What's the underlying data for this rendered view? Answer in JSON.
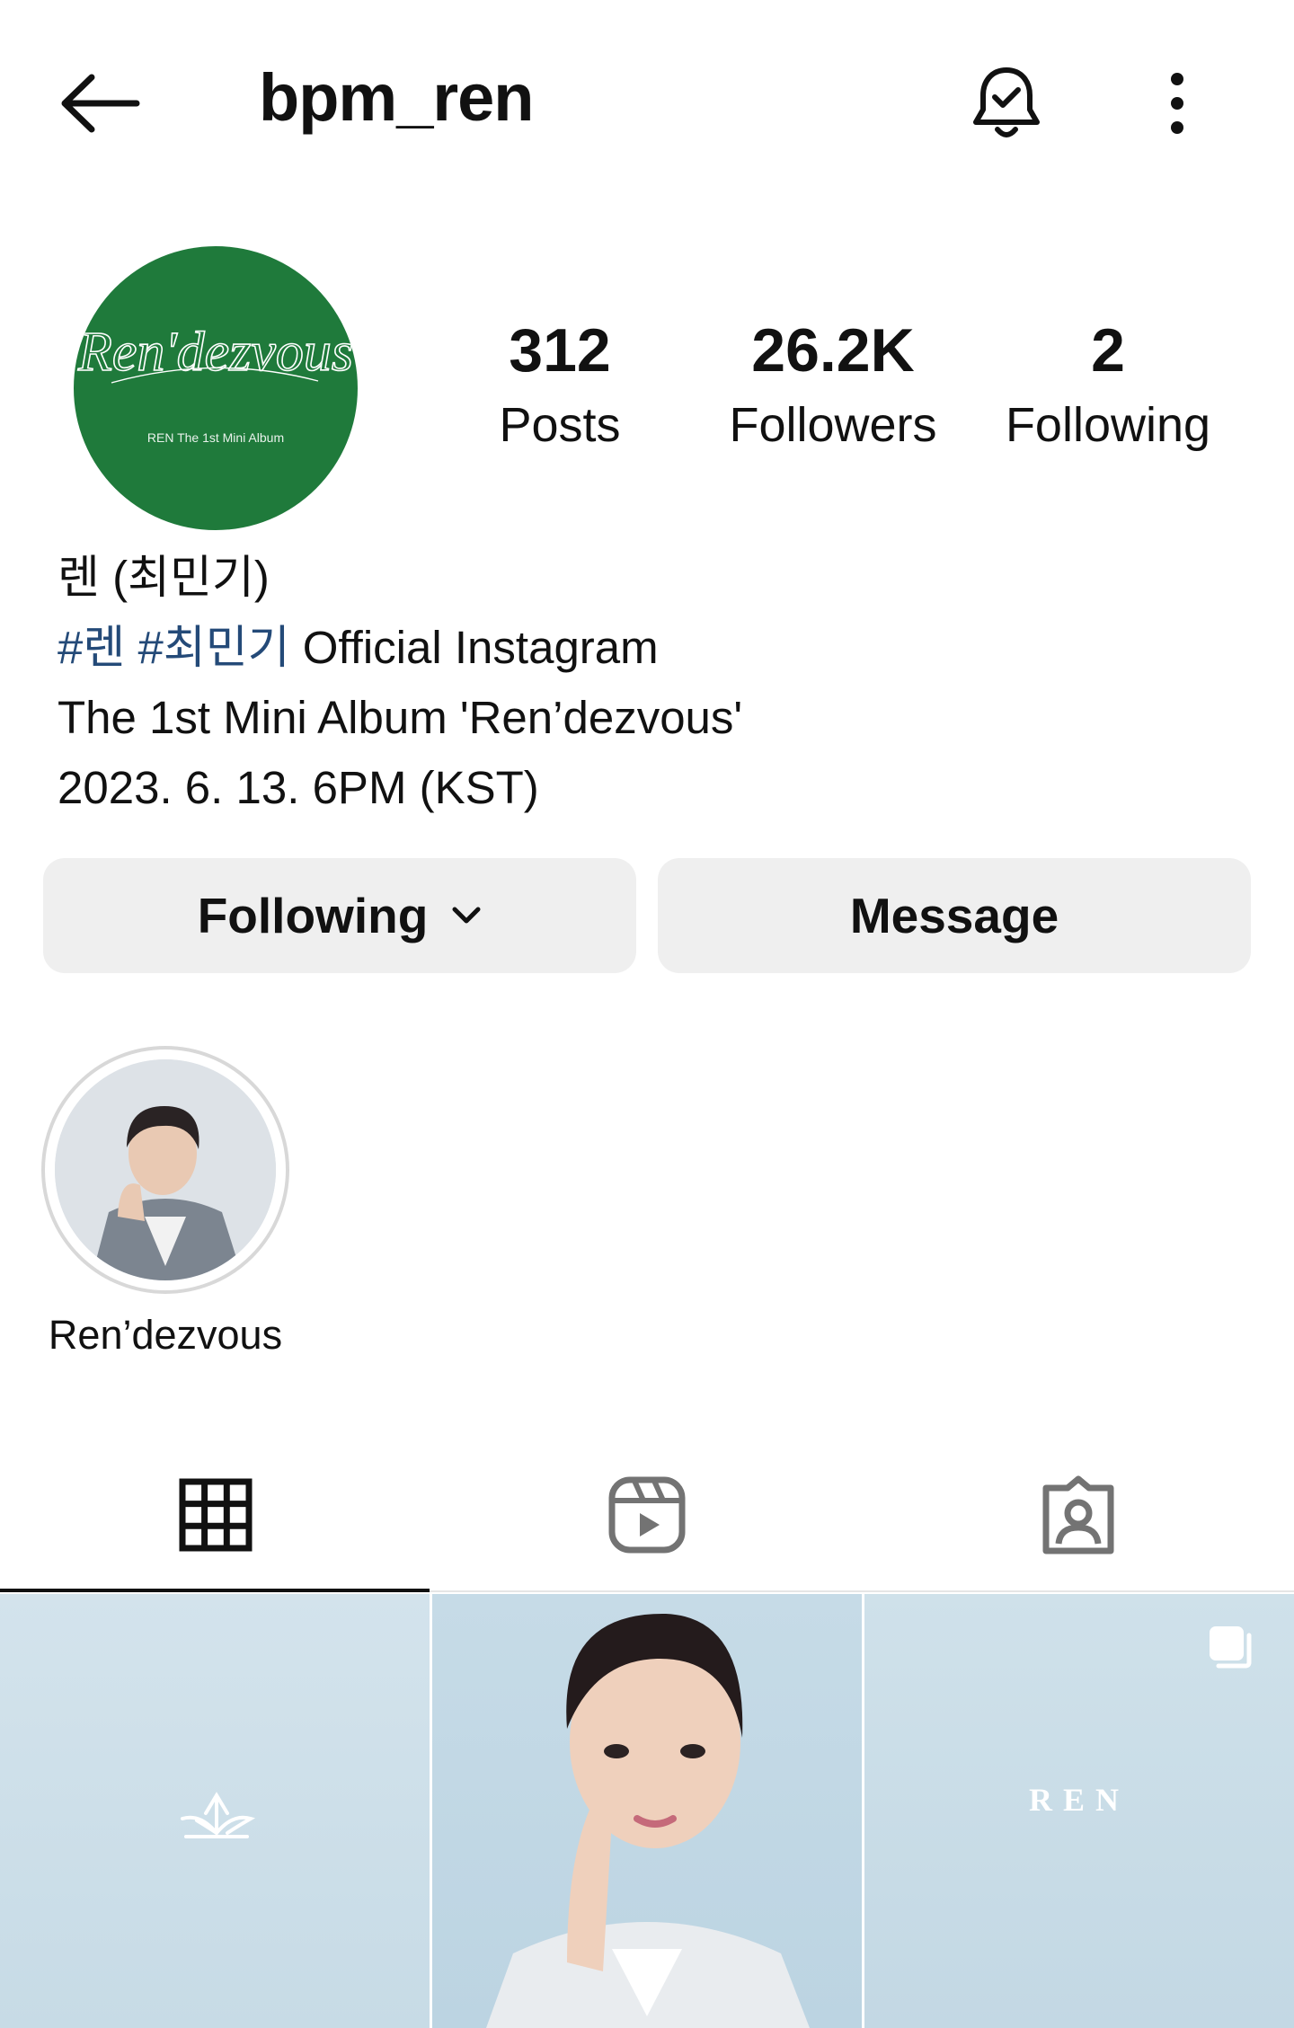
{
  "header": {
    "username": "bpm_ren"
  },
  "profile": {
    "avatar_text": "Ren'dezvous",
    "avatar_subtext": "REN The 1st Mini Album",
    "stats": [
      {
        "value": "312",
        "label": "Posts"
      },
      {
        "value": "26.2K",
        "label": "Followers"
      },
      {
        "value": "2",
        "label": "Following"
      }
    ]
  },
  "bio": {
    "name": "렌 (최민기)",
    "hashtag1": "#렌",
    "hashtag2": "#최민기",
    "line2_rest": " Official Instagram",
    "line3": "The 1st Mini Album 'Ren’dezvous'",
    "line4": "2023. 6. 13. 6PM (KST)"
  },
  "actions": {
    "following_label": "Following",
    "message_label": "Message"
  },
  "highlights": [
    {
      "label": "Ren’dezvous"
    }
  ],
  "tabs": [
    {
      "icon": "grid-icon",
      "active": true
    },
    {
      "icon": "reels-icon",
      "active": false
    },
    {
      "icon": "tagged-icon",
      "active": false
    }
  ],
  "posts": [
    {
      "overlay_text": ""
    },
    {
      "overlay_text": ""
    },
    {
      "overlay_text": "REN",
      "multi": true
    }
  ],
  "colors": {
    "avatar_bg": "#1f7a3b",
    "hashtag": "#244a78",
    "button_bg": "#efefef"
  }
}
